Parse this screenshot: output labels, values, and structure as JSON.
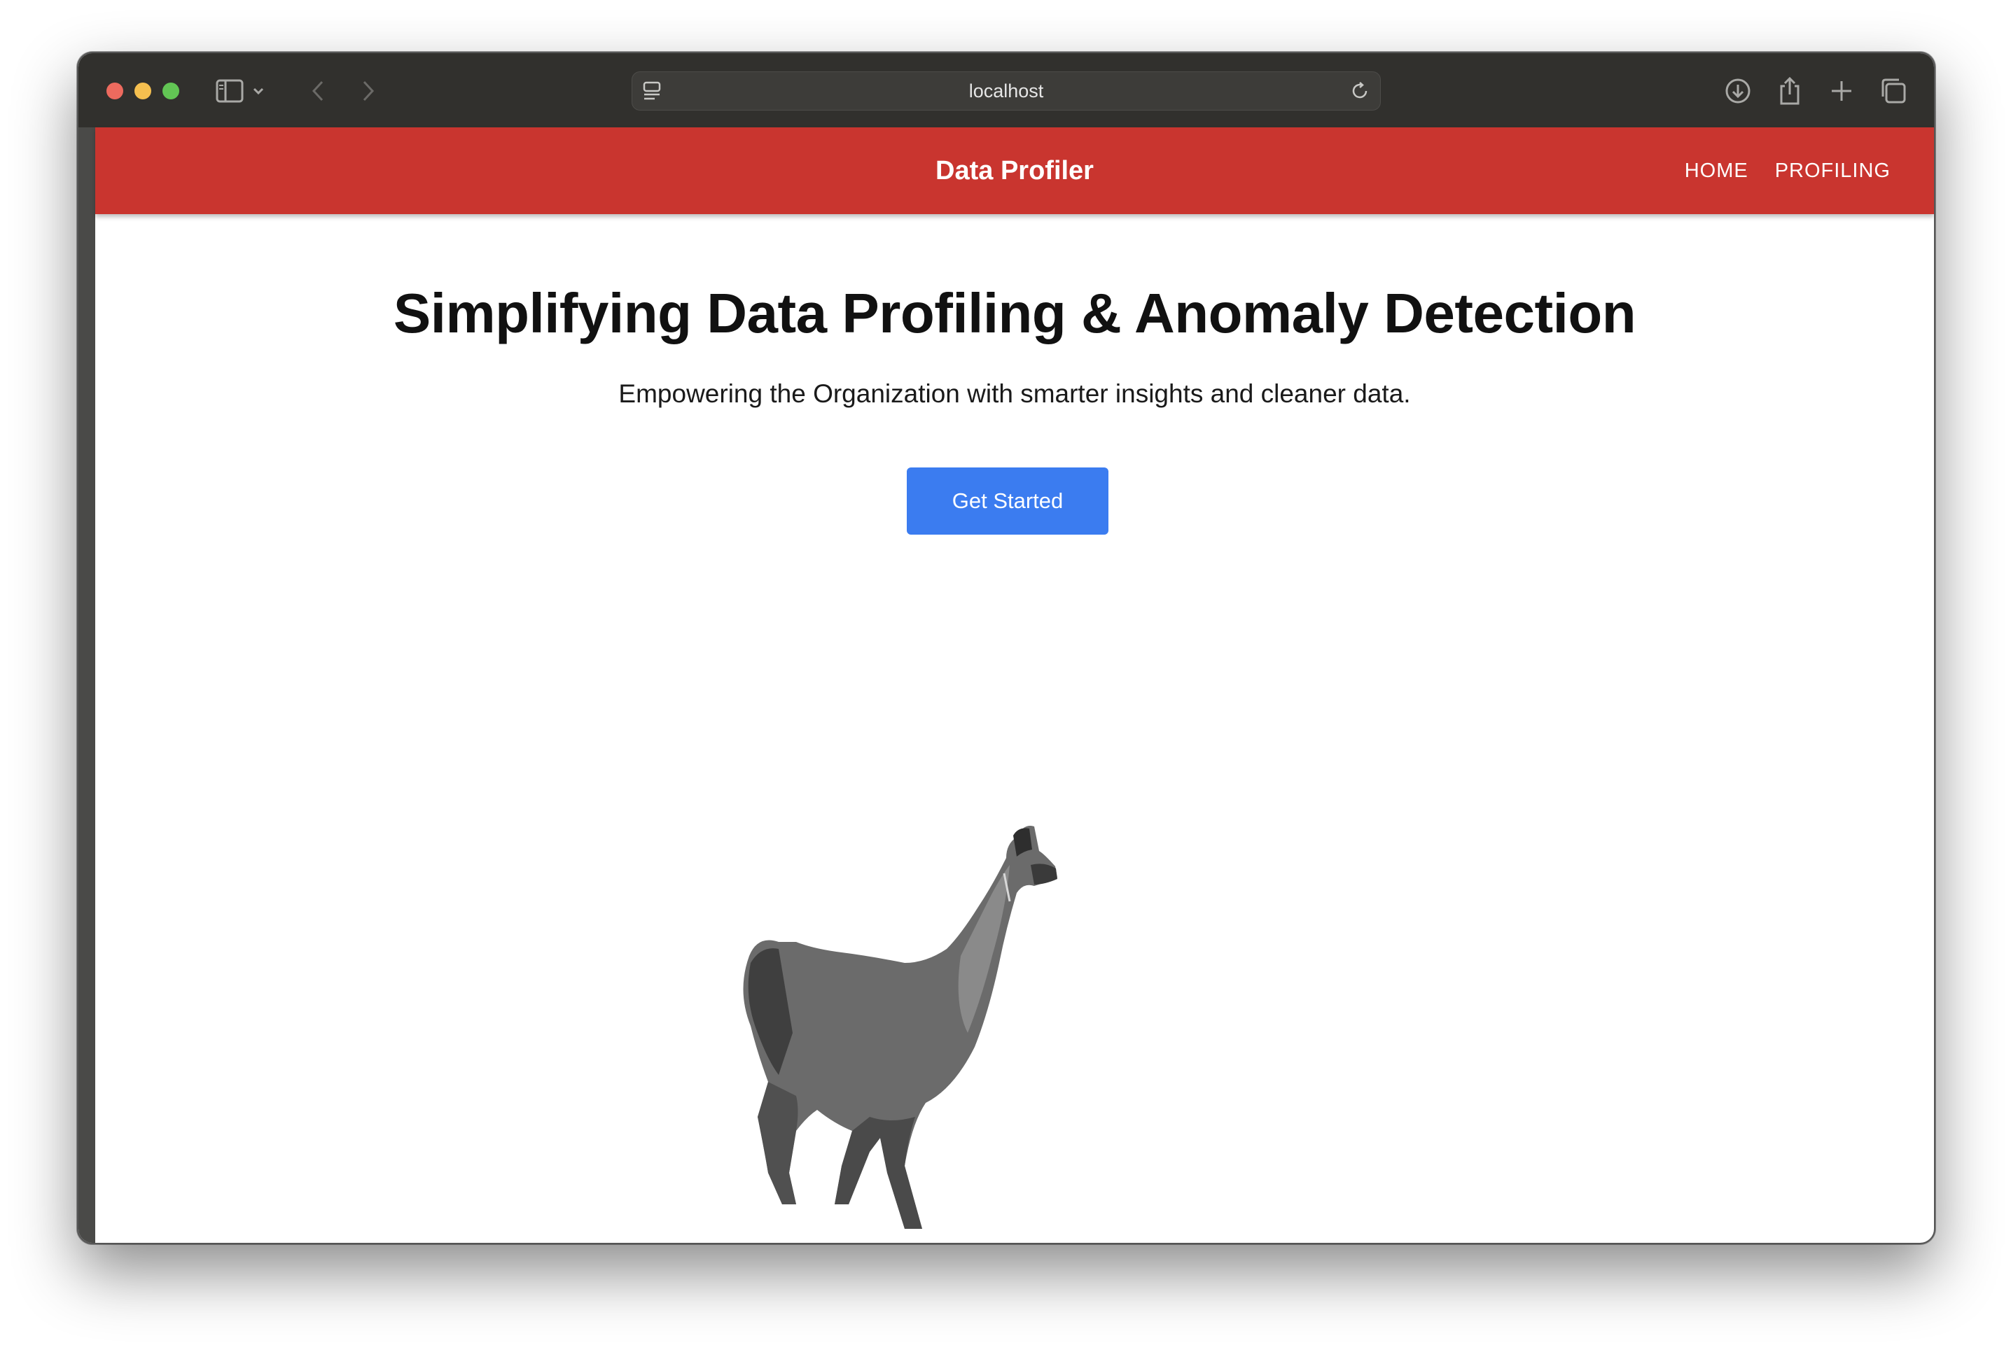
{
  "browser": {
    "url": "localhost",
    "icons": [
      "sidebar-toggle-icon",
      "chevron-down-icon",
      "back-arrow-icon",
      "forward-arrow-icon",
      "page-settings-icon",
      "reload-icon",
      "download-icon",
      "share-icon",
      "new-tab-icon",
      "tab-overview-icon"
    ]
  },
  "navbar": {
    "brand": "Data Profiler",
    "links": [
      "HOME",
      "PROFILING"
    ],
    "color": "#c9352f"
  },
  "hero": {
    "title": "Simplifying Data Profiling & Anomaly Detection",
    "subtitle": "Empowering the Organization with smarter insights and cleaner data.",
    "cta_label": "Get Started",
    "cta_color": "#3b7cf0",
    "image": "llama-illustration"
  }
}
